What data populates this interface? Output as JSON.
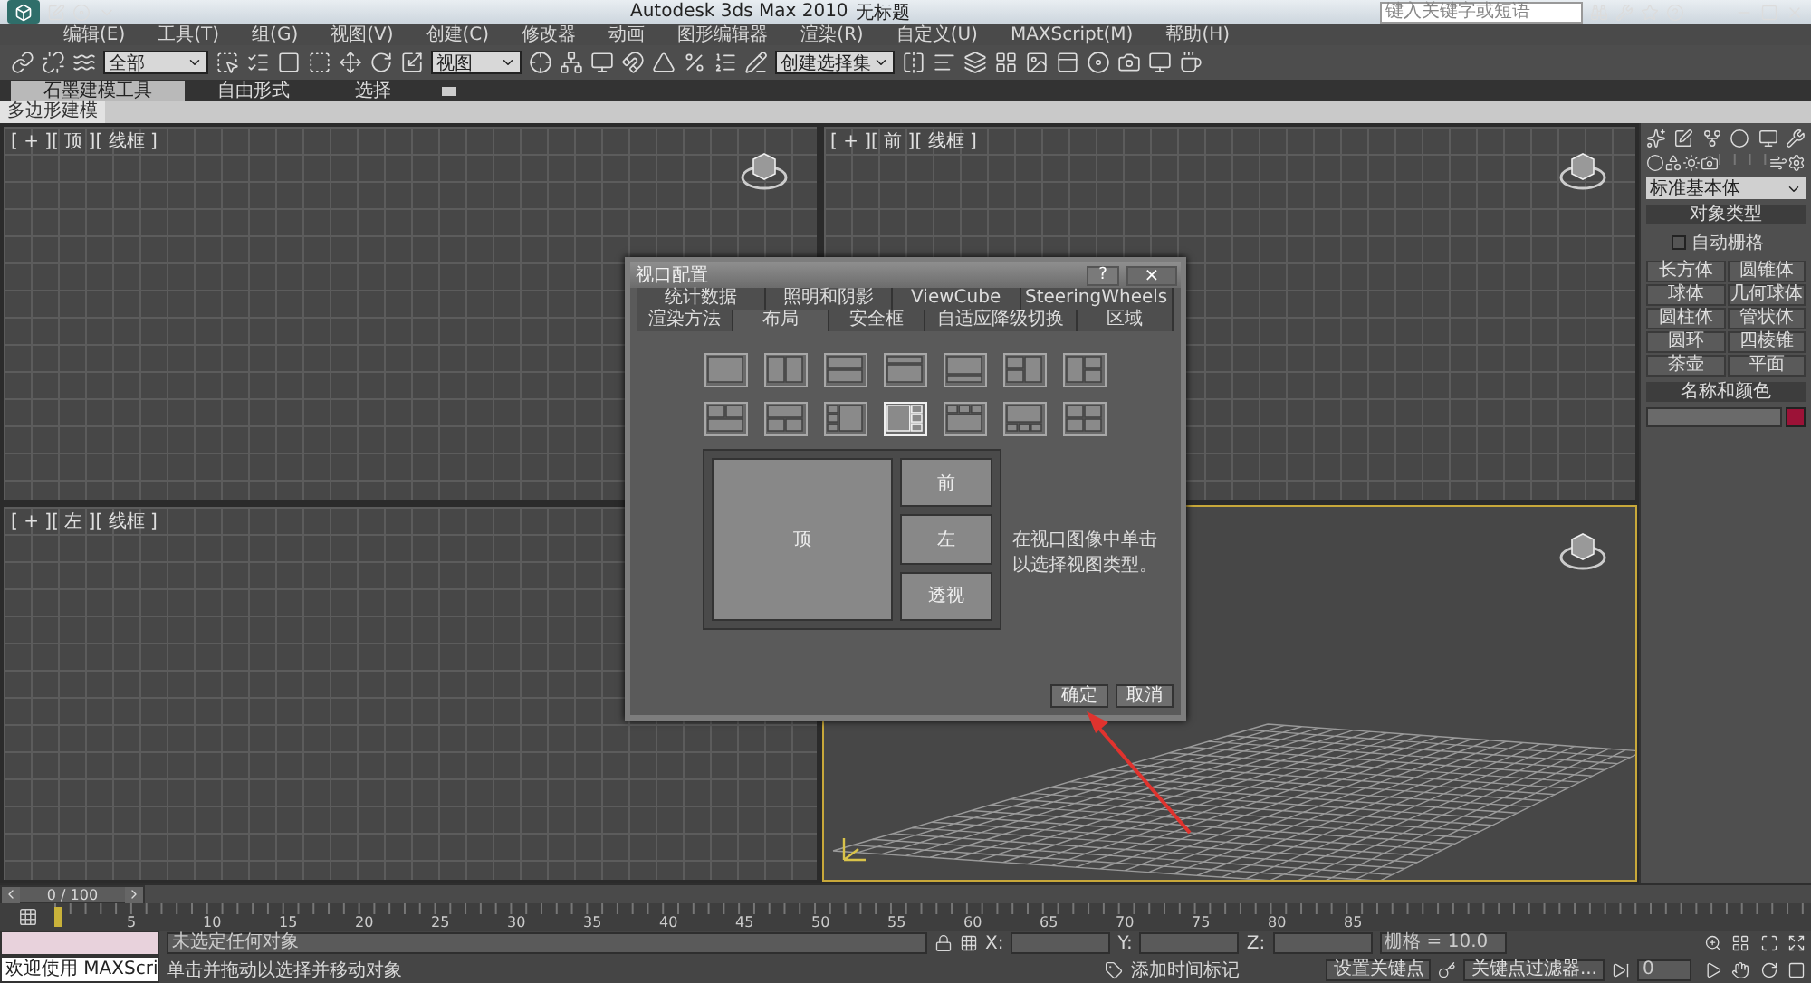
{
  "window": {
    "title": "Autodesk 3ds Max  2010",
    "document": "无标题",
    "search_placeholder": "键入关键字或短语"
  },
  "menu": [
    "编辑(E)",
    "工具(T)",
    "组(G)",
    "视图(V)",
    "创建(C)",
    "修改器",
    "动画",
    "图形编辑器",
    "渲染(R)",
    "自定义(U)",
    "MAXScript(M)",
    "帮助(H)"
  ],
  "toolbar": {
    "selection_filter": "全部",
    "reference_coord": "视图",
    "named_selection": "创建选择集"
  },
  "ribbon": {
    "tabs": [
      {
        "label": "石墨建模工具",
        "selected": true
      },
      {
        "label": "自由形式",
        "selected": false
      },
      {
        "label": "选择",
        "selected": false
      }
    ],
    "panel": "多边形建模"
  },
  "viewports": [
    {
      "label": "[ + ][ 顶 ][ 线框 ]",
      "kind": "grid",
      "active": false
    },
    {
      "label": "[ + ][ 前 ][ 线框 ]",
      "kind": "grid",
      "active": false
    },
    {
      "label": "[ + ][ 左 ][ 线框 ]",
      "kind": "grid",
      "active": false
    },
    {
      "kind": "perspective",
      "active": true
    }
  ],
  "dialog": {
    "title": "视口配置",
    "help": "?",
    "close": "×",
    "tabs_row1": [
      {
        "label": "统计数据",
        "selected": false
      },
      {
        "label": "照明和阴影",
        "selected": false
      },
      {
        "label": "ViewCube",
        "selected": false
      },
      {
        "label": "SteeringWheels",
        "selected": false
      }
    ],
    "tabs_row2": [
      {
        "label": "渲染方法",
        "selected": false
      },
      {
        "label": "布局",
        "selected": true
      },
      {
        "label": "安全框",
        "selected": false
      },
      {
        "label": "自适应降级切换",
        "selected": false
      },
      {
        "label": "区域",
        "selected": false
      }
    ],
    "layouts": [
      {
        "kind": "single",
        "selected": false
      },
      {
        "kind": "split-v",
        "selected": false
      },
      {
        "kind": "split-h",
        "selected": false
      },
      {
        "kind": "top-small",
        "selected": false
      },
      {
        "kind": "bottom-small",
        "selected": false
      },
      {
        "kind": "left-2-right-1",
        "selected": false
      },
      {
        "kind": "left-1-right-2",
        "selected": false
      },
      {
        "kind": "top-2-bottom-1",
        "selected": false
      },
      {
        "kind": "top-1-bottom-2",
        "selected": false
      },
      {
        "kind": "left-3-right-1",
        "selected": false
      },
      {
        "kind": "left-1-right-3",
        "selected": true
      },
      {
        "kind": "top-3-bottom-1",
        "selected": false
      },
      {
        "kind": "top-1-bottom-3",
        "selected": false
      },
      {
        "kind": "quad",
        "selected": false
      }
    ],
    "panes": [
      "顶",
      "前",
      "左",
      "透视"
    ],
    "hint": "在视口图像中单击以选择视图类型。",
    "buttons": [
      "确定",
      "取消"
    ]
  },
  "command_panel": {
    "dropdown": "标准基本体",
    "object_type": {
      "title": "对象类型",
      "checkbox": {
        "label": "自动栅格",
        "checked": false
      },
      "buttons": [
        "长方体",
        "圆锥体",
        "球体",
        "几何球体",
        "圆柱体",
        "管状体",
        "圆环",
        "四棱锥",
        "茶壶",
        "平面"
      ]
    },
    "name_color": {
      "title": "名称和颜色",
      "color": "#9c1237"
    }
  },
  "timeline": {
    "position": "0 / 100",
    "level": 0
  },
  "ruler_labels": [
    "5",
    "10",
    "15",
    "20",
    "25",
    "30",
    "35",
    "40",
    "45",
    "50",
    "55",
    "60",
    "65",
    "70",
    "75",
    "80",
    "85"
  ],
  "status": {
    "listener": "欢迎使用 MAXScri",
    "selection": "未选定任何对象",
    "prompt": "单击并拖动以选择并移动对象",
    "x": "X:",
    "y": "Y:",
    "z": "Z:",
    "grid": "栅格 = 10.0",
    "time_tag": "添加时间标记",
    "set_key": "设置关键点",
    "key_filters": "关键点过滤器...",
    "frame": "0"
  }
}
